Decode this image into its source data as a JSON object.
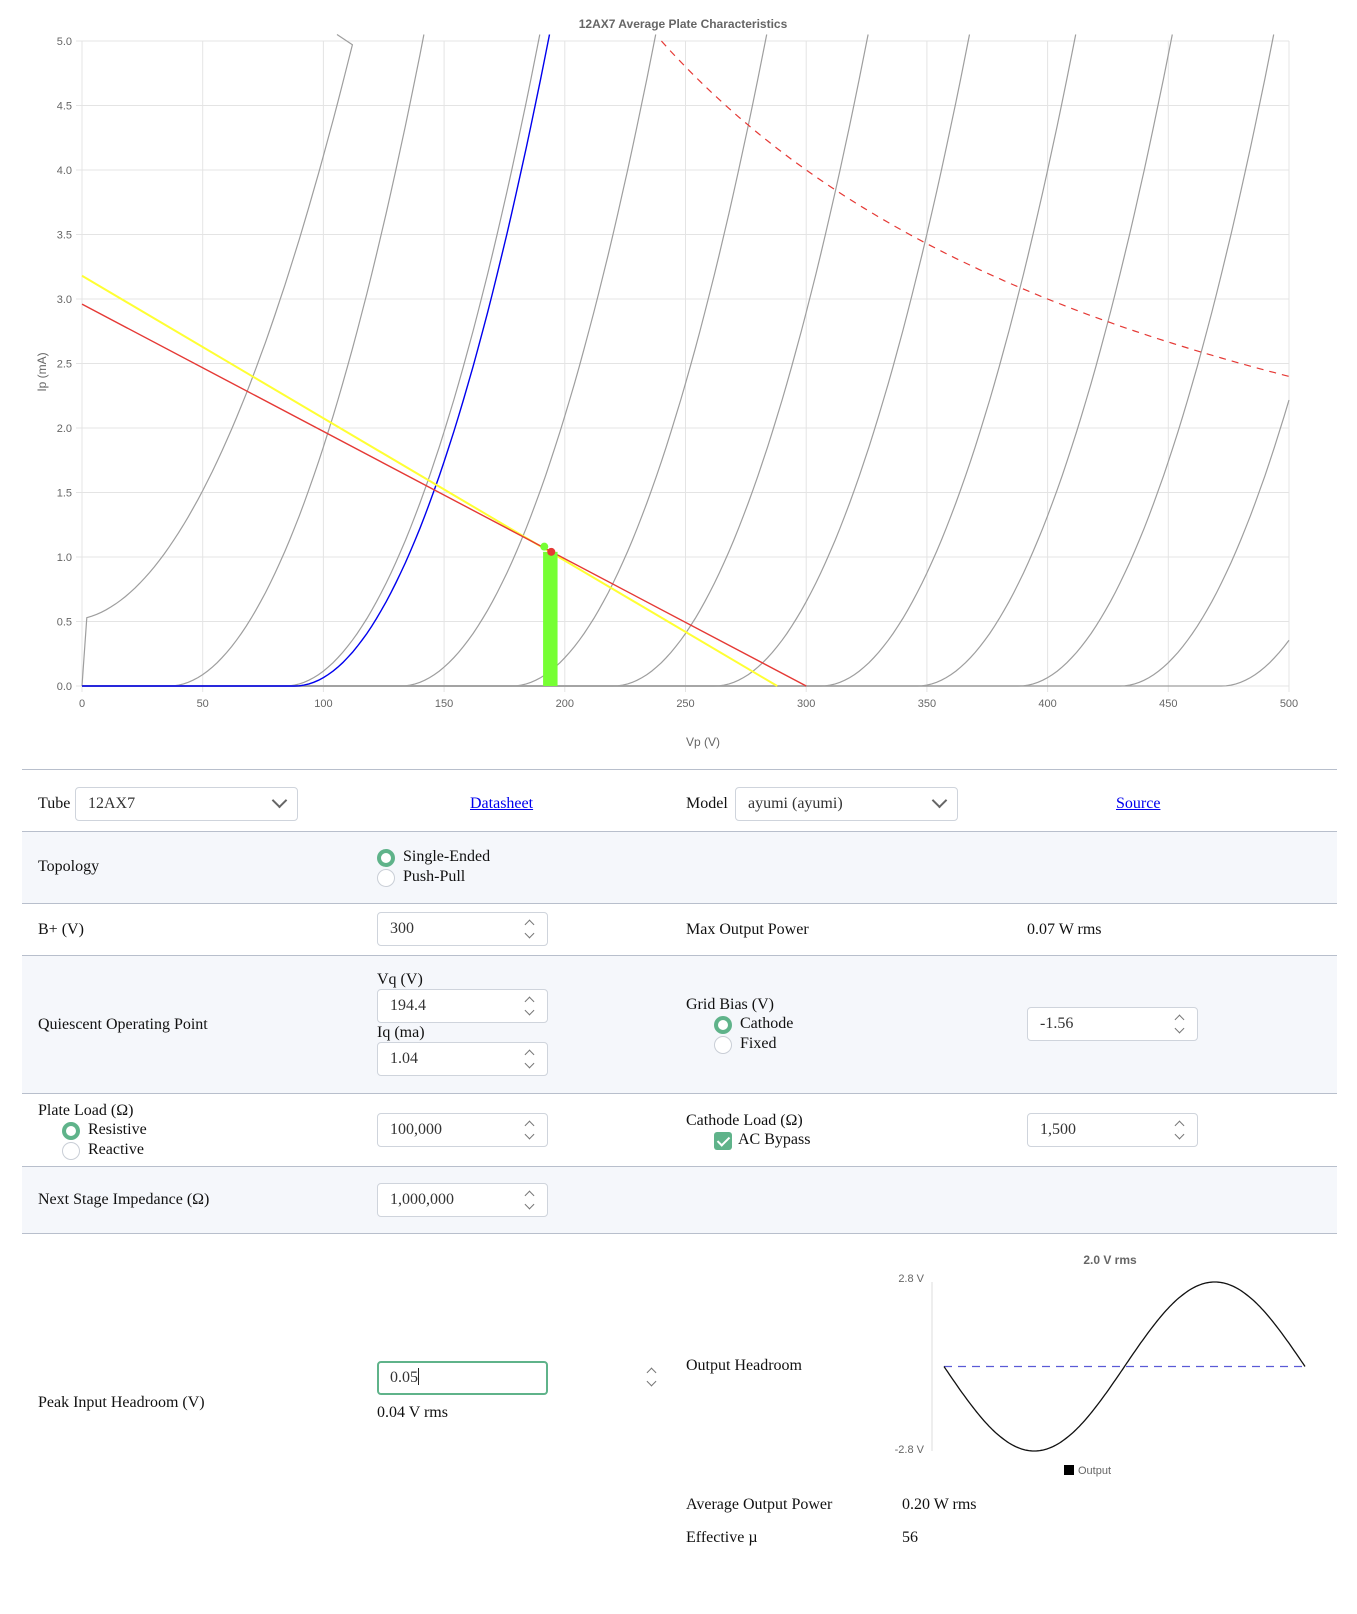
{
  "chart_data": {
    "type": "line",
    "title": "12AX7 Average Plate Characteristics",
    "xlabel": "Vp (V)",
    "ylabel": "Ip (mA)",
    "xlim": [
      0,
      500
    ],
    "ylim": [
      0,
      5
    ],
    "x_ticks": [
      "0",
      "50",
      "100",
      "150",
      "200",
      "250",
      "300",
      "350",
      "400",
      "450",
      "500"
    ],
    "y_ticks": [
      "0.0",
      "0.5",
      "1.0",
      "1.5",
      "2.0",
      "2.5",
      "3.0",
      "3.5",
      "4.0",
      "4.5",
      "5.0"
    ],
    "grid": true,
    "grid_curves_color": "#9e9e9e",
    "grid_curve_offsets_v": [
      0,
      36,
      84,
      132,
      178,
      220,
      262,
      306,
      346,
      388,
      430,
      472
    ],
    "operating_curve": {
      "color": "#0000ee",
      "offset_v": 88
    },
    "dc_load_line": {
      "color": "#e53935",
      "points": [
        [
          0,
          2.96
        ],
        [
          300,
          0
        ]
      ]
    },
    "ac_load_line": {
      "color": "#ffff33",
      "points": [
        [
          0,
          3.18
        ],
        [
          288,
          0
        ]
      ]
    },
    "max_dissipation": {
      "color": "#e53935",
      "dashed": true,
      "watts": 1.2
    },
    "quiescent_point": {
      "vq": 194.4,
      "iq": 1.04,
      "color": "#e53935"
    },
    "swing_bar": {
      "color": "#76ff33",
      "x_from": 191,
      "x_to": 197,
      "y": 1.04
    }
  },
  "headroom_chart": {
    "type": "line",
    "title": "2.0 V rms",
    "y_ticks": [
      "2.8 V",
      "-2.8 V"
    ],
    "ylim": [
      -2.8,
      2.8
    ],
    "series": [
      {
        "name": "Output",
        "color": "#111111",
        "amplitude": 2.8
      }
    ],
    "center_line_color": "#5a5ad6"
  },
  "form": {
    "tube_label": "Tube",
    "tube_value": "12AX7",
    "datasheet_link": "Datasheet",
    "model_label": "Model",
    "model_value": "ayumi (ayumi)",
    "source_link": "Source",
    "topology_label": "Topology",
    "topology_options": [
      "Single-Ended",
      "Push-Pull"
    ],
    "bplus_label": "B+ (V)",
    "bplus_value": "300",
    "max_output_label": "Max Output Power",
    "max_output_value": "0.07 W rms",
    "quiescent_label": "Quiescent Operating Point",
    "vq_label": "Vq (V)",
    "vq_value": "194.4",
    "iq_label": "Iq (ma)",
    "iq_value": "1.04",
    "grid_bias_label": "Grid Bias (V)",
    "grid_bias_options": [
      "Cathode",
      "Fixed"
    ],
    "grid_bias_value": "-1.56",
    "plate_load_label": "Plate Load (Ω)",
    "plate_load_options": [
      "Resistive",
      "Reactive"
    ],
    "plate_load_value": "100,000",
    "cathode_load_label": "Cathode Load (Ω)",
    "ac_bypass_label": "AC Bypass",
    "cathode_load_value": "1,500",
    "next_stage_label": "Next Stage Impedance (Ω)",
    "next_stage_value": "1,000,000",
    "peak_input_label": "Peak Input Headroom (V)",
    "peak_input_value": "0.05",
    "peak_input_rms": "0.04 V rms",
    "output_headroom_label": "Output Headroom",
    "avg_output_label": "Average Output Power",
    "avg_output_value": "0.20 W rms",
    "eff_mu_label": "Effective µ",
    "eff_mu_value": "56"
  }
}
